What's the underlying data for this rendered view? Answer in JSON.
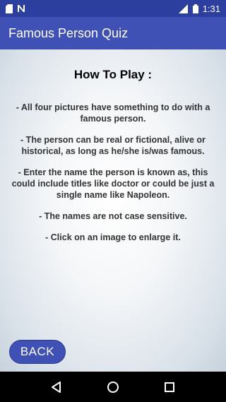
{
  "status_bar": {
    "time": "1:31",
    "network": "LTE"
  },
  "app_bar": {
    "title": "Famous Person Quiz"
  },
  "content": {
    "heading": "How To Play :",
    "rules": [
      "- All four pictures have something to do with a famous person.",
      "- The person can be real or fictional, alive or historical, as long as he/she is/was famous.",
      "- Enter the name the person is known as, this could include titles like doctor or could be just a single name like Napoleon.",
      "- The names are not case sensitive.",
      "- Click on an image to enlarge it."
    ],
    "back_label": "BACK"
  },
  "colors": {
    "status_bar": "#2c3f9e",
    "app_bar": "#3f51b5",
    "button": "#3f51b5"
  },
  "icons": {
    "status_left": [
      "sd-card-icon",
      "n-notification-icon"
    ],
    "status_right": [
      "lte-signal-icon",
      "battery-icon"
    ],
    "nav": [
      "back-triangle-icon",
      "home-circle-icon",
      "recents-square-icon"
    ]
  }
}
